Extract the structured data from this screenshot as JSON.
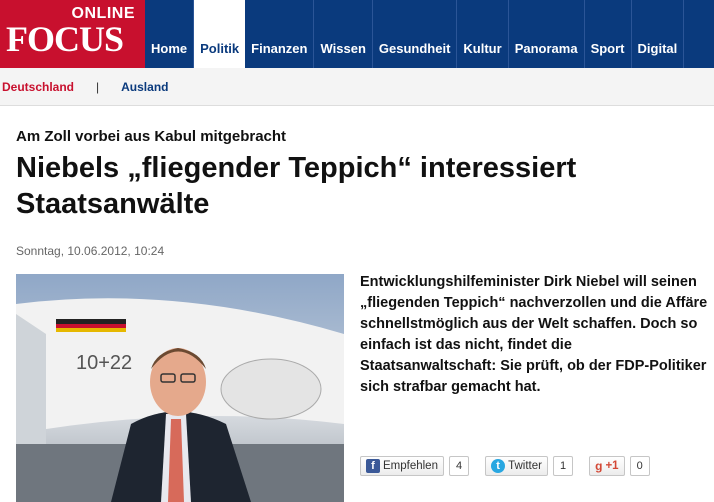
{
  "brand": {
    "online": "ONLINE",
    "focus": "FOCUS"
  },
  "nav": {
    "tabs": [
      "Home",
      "Politik",
      "Finanzen",
      "Wissen",
      "Gesundheit",
      "Kultur",
      "Panorama",
      "Sport",
      "Digital"
    ],
    "active": "Politik"
  },
  "subnav": {
    "deutschland": "Deutschland",
    "separator": "|",
    "ausland": "Ausland"
  },
  "article": {
    "kicker": "Am Zoll vorbei aus Kabul mitgebracht",
    "headline": "Niebels „fliegender Teppich“ interessiert Staatsanwälte",
    "date": "Sonntag, 10.06.2012, 10:24",
    "lead": "Entwicklungshilfeminister Dirk Niebel will seinen „fliegenden Teppich“ nachverzollen und die Affäre schnellstmöglich aus der Welt schaffen. Doch so einfach ist das nicht, findet die Staatsanwaltschaft: Sie prüft, ob der FDP-Politiker sich strafbar gemacht hat."
  },
  "photo": {
    "plane_text": "10+22"
  },
  "social": {
    "facebook_label": "Empfehlen",
    "facebook_count": "4",
    "twitter_label": "Twitter",
    "twitter_count": "1",
    "gplus_label": "+1",
    "gplus_count": "0"
  }
}
